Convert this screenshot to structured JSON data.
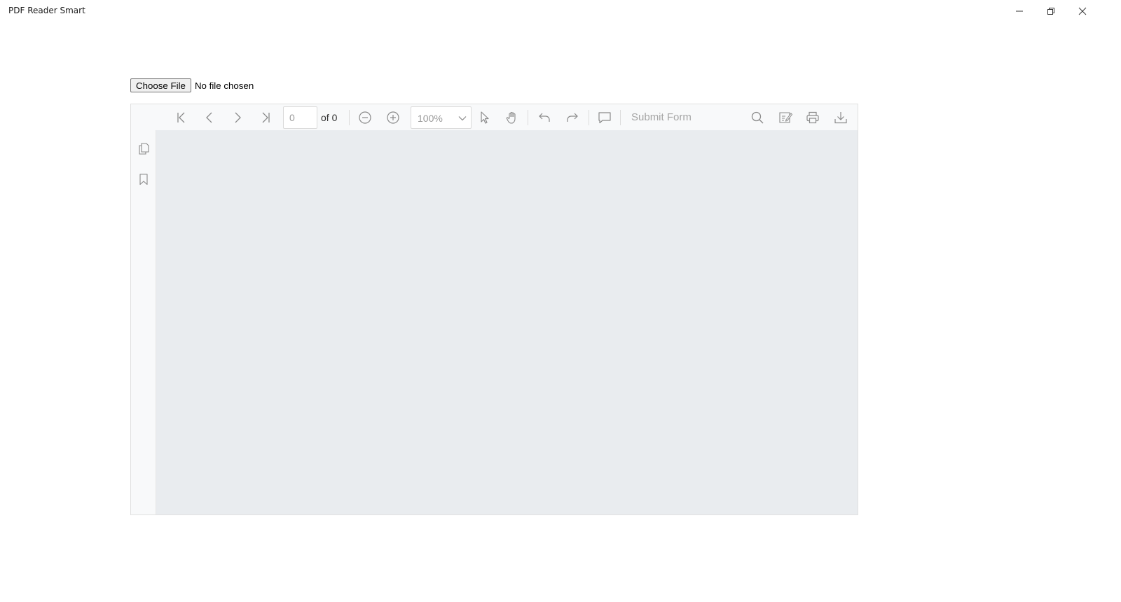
{
  "window": {
    "title": "PDF Reader Smart",
    "controls": [
      "minimize-icon",
      "restore-icon",
      "close-icon"
    ]
  },
  "file_input": {
    "button_label": "Choose File",
    "status": "No file chosen"
  },
  "toolbar": {
    "page_value": "0",
    "page_total_label": "of 0",
    "zoom_value": "100%",
    "submit_form_label": "Submit Form",
    "icons": [
      "first-page-icon",
      "previous-page-icon",
      "next-page-icon",
      "last-page-icon",
      "zoom-out-icon",
      "zoom-in-icon",
      "chevron-down-icon",
      "select-pointer-icon",
      "pan-hand-icon",
      "undo-icon",
      "redo-icon",
      "comment-icon",
      "search-icon",
      "annotation-icon",
      "print-icon",
      "download-icon"
    ]
  },
  "sidebar": {
    "icons": [
      "thumbnails-icon",
      "bookmark-icon"
    ]
  },
  "colors": {
    "toolbar_bg": "#f8f9fa",
    "canvas_bg": "#e9ecef",
    "icon_color": "#8a8a8a",
    "disabled_text": "#a5a5a5"
  }
}
